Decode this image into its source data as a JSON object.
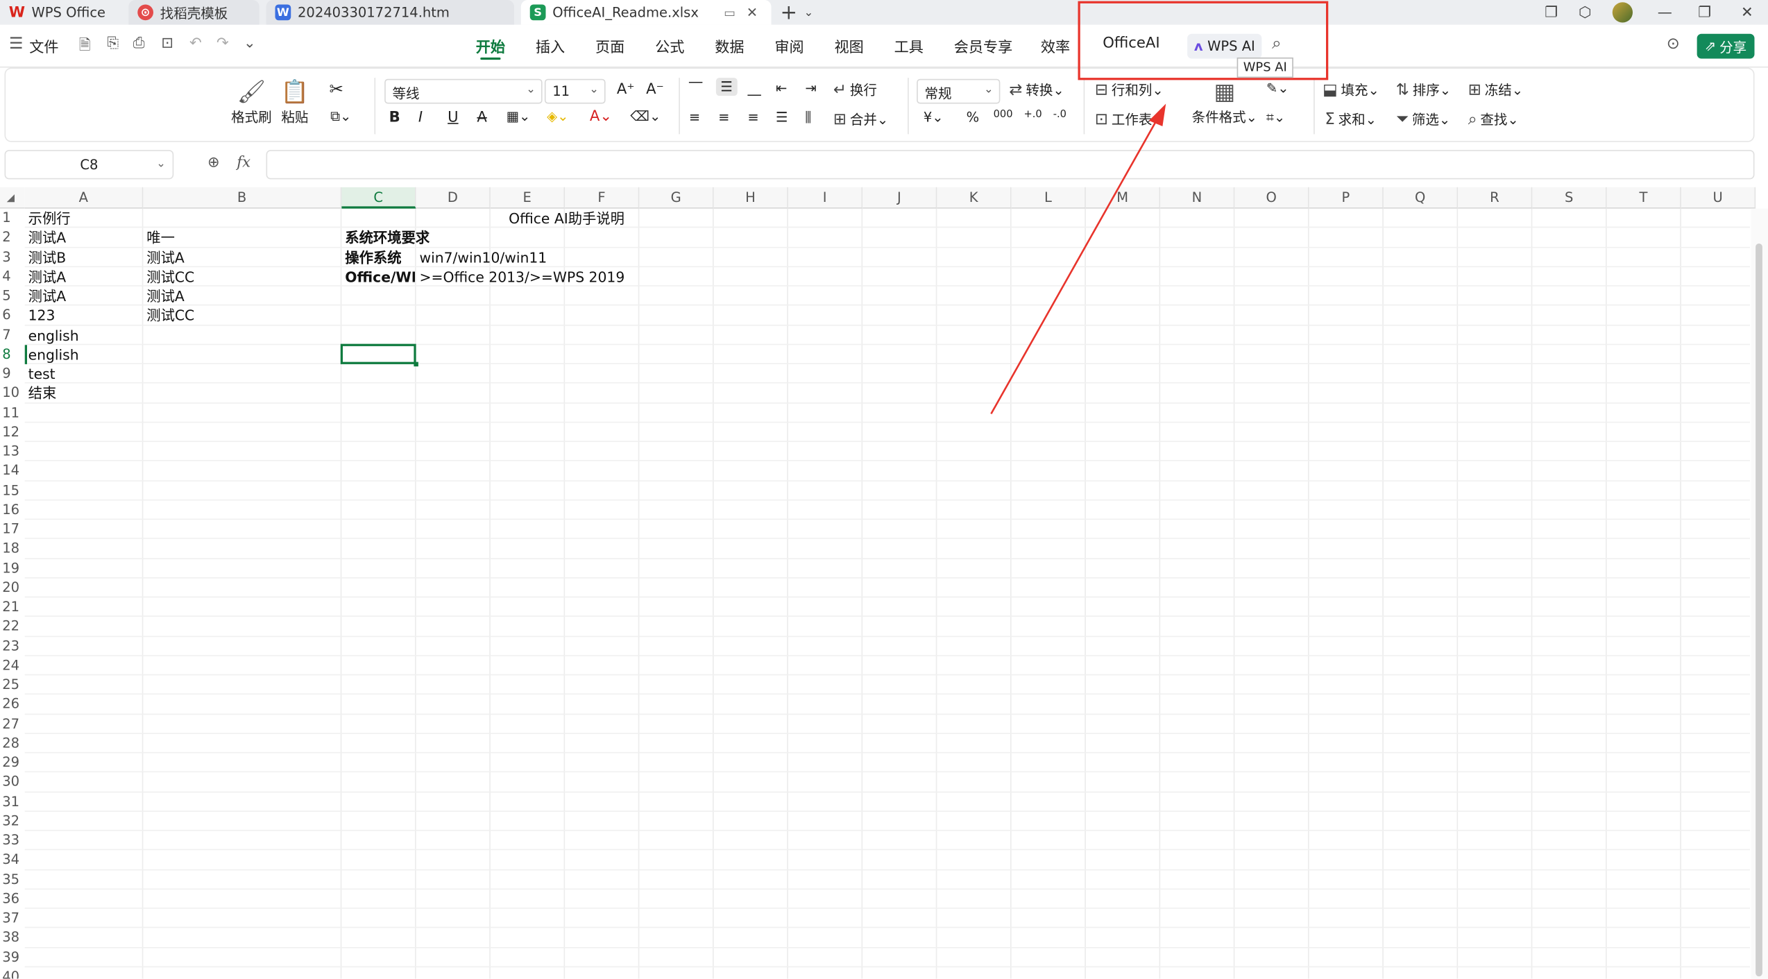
{
  "tabs": [
    {
      "label": "WPS Office",
      "icon": "wps-logo-icon"
    },
    {
      "label": "找稻壳模板",
      "icon": "docer-icon"
    },
    {
      "label": "20240330172714.htm",
      "icon": "word-doc-icon"
    },
    {
      "label": "OfficeAI_Readme.xlsx",
      "icon": "sheet-icon"
    }
  ],
  "menubar": {
    "file": "文件",
    "items": [
      "开始",
      "插入",
      "页面",
      "公式",
      "数据",
      "审阅",
      "视图",
      "工具",
      "会员专享",
      "效率",
      "OfficeAI"
    ],
    "wps_ai": "WPS AI",
    "tooltip": "WPS AI",
    "share": "分享"
  },
  "ribbon": {
    "format_painter": "格式刷",
    "paste": "粘贴",
    "font_name": "等线",
    "font_size": "11",
    "wrap": "换行",
    "merge": "合并",
    "number_format": "常规",
    "convert": "转换",
    "rows_cols": "行和列",
    "worksheet": "工作表",
    "cond_format": "条件格式",
    "fill": "填充",
    "sort": "排序",
    "freeze": "冻结",
    "sum": "求和",
    "filter": "筛选",
    "find": "查找",
    "bold": "B",
    "italic": "I",
    "underline": "U",
    "strike": "A",
    "font_color": "A",
    "yuan": "¥",
    "percent": "%",
    "thousands": "000",
    "dec_inc": "+.0",
    "dec_dec": "-.0"
  },
  "formula_bar": {
    "cell_ref": "C8",
    "fx": "fx",
    "content": ""
  },
  "columns": [
    "A",
    "B",
    "C",
    "D",
    "E",
    "F",
    "G",
    "H",
    "I",
    "J",
    "K",
    "L",
    "M",
    "N",
    "O",
    "P",
    "Q",
    "R",
    "S",
    "T",
    "U"
  ],
  "rows": [
    "1",
    "2",
    "3",
    "4",
    "5",
    "6",
    "7",
    "8",
    "9",
    "10",
    "11",
    "12",
    "13",
    "14",
    "15",
    "16",
    "17",
    "18",
    "19",
    "20",
    "21",
    "22",
    "23",
    "24",
    "25",
    "26",
    "27",
    "28",
    "29",
    "30",
    "31",
    "32",
    "33",
    "34",
    "35",
    "36",
    "37",
    "38",
    "39",
    "40"
  ],
  "cells": {
    "A1": "示例行",
    "A2": "测试A",
    "B2": "唯一",
    "C2": "系统环境要求",
    "A3": "测试B",
    "B3": "测试A",
    "C3": "操作系统",
    "D3": "win7/win10/win11",
    "A4": "测试A",
    "B4": "测试CC",
    "C4": "Office/WPS",
    "D4": ">=Office 2013/>=WPS 2019",
    "A5": "测试A",
    "B5": "测试A",
    "A6": "123",
    "B6": "测试CC",
    "A7": "english",
    "A8": "english",
    "A9": "test",
    "A10": "结束",
    "title": "Office AI助手说明"
  },
  "colors": {
    "accent": "#0f7b3f",
    "highlight": "#e8342c",
    "share": "#138a5a"
  }
}
